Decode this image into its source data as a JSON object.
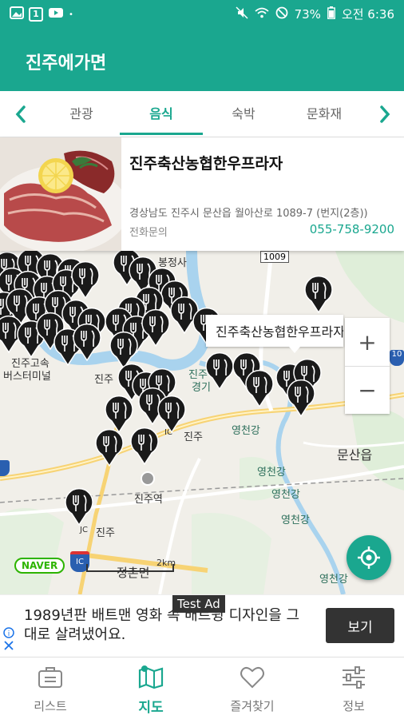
{
  "status_bar": {
    "battery": "73%",
    "time": "오전 6:36",
    "notif_icon_1": "1"
  },
  "app_bar": {
    "title": "진주에가면"
  },
  "tabs": [
    {
      "label": "관광",
      "active": false
    },
    {
      "label": "음식",
      "active": true
    },
    {
      "label": "숙박",
      "active": false
    },
    {
      "label": "문화재",
      "active": false
    }
  ],
  "place": {
    "name": "진주축산농협한우프라자",
    "address": "경상남도 진주시 문산읍 월아산로 1089-7 (번지(2층))",
    "call_label": "전화문의",
    "phone": "055-758-9200"
  },
  "map": {
    "callout": "진주축산농협한우프라자",
    "zoom_in": "+",
    "zoom_out": "−",
    "labels": {
      "bujeongsa": "봉정사",
      "bus_terminal_1": "진주고속",
      "bus_terminal_2": "버스터미널",
      "jinju_station": "진주역",
      "jinju_ic": "진주",
      "jinju_jc": "진주",
      "jinju_ic_2": "진주",
      "yeongcheon_1": "영천강",
      "yeongcheon_2": "영천강",
      "yeongcheon_3": "영천강",
      "yeongcheon_4": "영천강",
      "yeongcheon_5": "영천강",
      "munsan": "문산읍",
      "jeongchon": "정촌면",
      "route_1009": "1009",
      "route_10": "10",
      "jc": "JC",
      "ic": "IC",
      "gyeong": "경기",
      "jin": "진주"
    },
    "naver_logo": "NAVER",
    "scale": "2km"
  },
  "ad": {
    "badge": "Test Ad",
    "text": "1989년판 배트맨 영화 속 배트윙 디자인을 그대로 살려냈어요.",
    "button": "보기"
  },
  "bottom_nav": [
    {
      "label": "리스트",
      "icon": "briefcase-icon",
      "active": false
    },
    {
      "label": "지도",
      "icon": "map-icon",
      "active": true
    },
    {
      "label": "즐겨찾기",
      "icon": "heart-icon",
      "active": false
    },
    {
      "label": "정보",
      "icon": "sliders-icon",
      "active": false
    }
  ],
  "colors": {
    "accent": "#1aa78f",
    "pin": "#1a1a1a"
  }
}
